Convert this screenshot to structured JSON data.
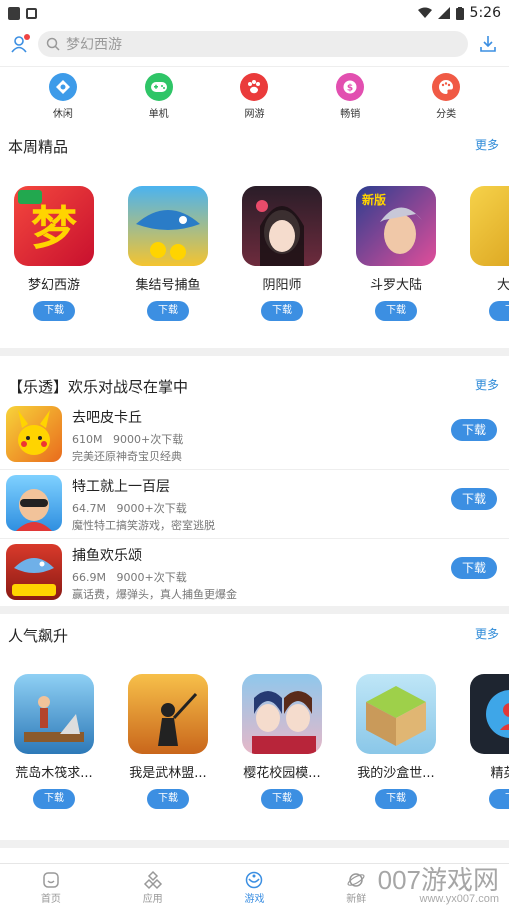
{
  "status": {
    "time": "5:26"
  },
  "search": {
    "placeholder": "梦幻西游"
  },
  "categories": [
    {
      "label": "休闲",
      "color": "#3d9be9",
      "icon": "diamond-icon"
    },
    {
      "label": "单机",
      "color": "#2fc567",
      "icon": "gamepad-icon"
    },
    {
      "label": "网游",
      "color": "#ea3b3b",
      "icon": "paw-icon"
    },
    {
      "label": "畅销",
      "color": "#e24fb0",
      "icon": "coin-icon"
    },
    {
      "label": "分类",
      "color": "#f05a45",
      "icon": "palette-icon"
    }
  ],
  "weekly": {
    "title": "本周精品",
    "more": "更多",
    "apps": [
      {
        "name": "梦幻西游",
        "btn": "下载"
      },
      {
        "name": "集结号捕鱼",
        "btn": "下载"
      },
      {
        "name": "阴阳师",
        "btn": "下载"
      },
      {
        "name": "斗罗大陆",
        "btn": "下载"
      },
      {
        "name": "大话",
        "btn": "下"
      }
    ]
  },
  "promo": {
    "title": "【乐透】欢乐对战尽在掌中",
    "more": "更多",
    "items": [
      {
        "title": "去吧皮卡丘",
        "size": "610M",
        "downloads": "9000+次下载",
        "desc": "完美还原神奇宝贝经典",
        "btn": "下载"
      },
      {
        "title": "特工就上一百层",
        "size": "64.7M",
        "downloads": "9000+次下载",
        "desc": "魔性特工搞笑游戏，密室逃脱",
        "btn": "下载"
      },
      {
        "title": "捕鱼欢乐颂",
        "size": "66.9M",
        "downloads": "9000+次下载",
        "desc": "赢话费，爆弹头，真人捕鱼更爆金",
        "btn": "下载"
      }
    ]
  },
  "rising": {
    "title": "人气飙升",
    "more": "更多",
    "apps": [
      {
        "name": "荒岛木筏求...",
        "btn": "下载"
      },
      {
        "name": "我是武林盟...",
        "btn": "下载"
      },
      {
        "name": "樱花校园模...",
        "btn": "下载"
      },
      {
        "name": "我的沙盒世...",
        "btn": "下载"
      },
      {
        "name": "精英射",
        "btn": "下"
      }
    ]
  },
  "nav": [
    {
      "label": "首页"
    },
    {
      "label": "应用"
    },
    {
      "label": "游戏"
    },
    {
      "label": "新鲜"
    },
    {
      "label": ""
    }
  ],
  "watermark": {
    "main": "007游戏网",
    "sub": "www.yx007.com"
  }
}
